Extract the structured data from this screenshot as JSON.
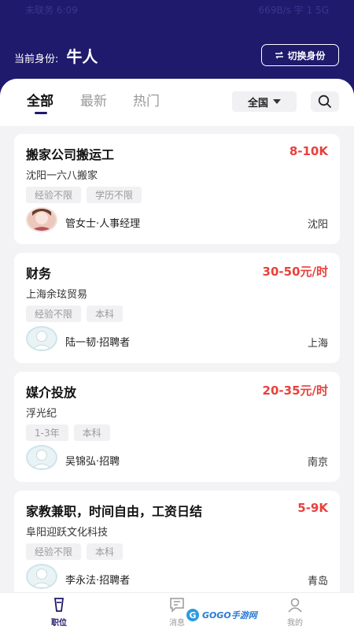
{
  "status_bar": {
    "left": "未联务 6:09",
    "right": "669B/s 宇 1 5G"
  },
  "header": {
    "identity_label": "当前身份:",
    "identity_value": "牛人",
    "switch_label": "切换身份"
  },
  "tabs": [
    {
      "label": "全部",
      "active": true
    },
    {
      "label": "最新",
      "active": false
    },
    {
      "label": "热门",
      "active": false
    }
  ],
  "region": "全国",
  "jobs": [
    {
      "title": "搬家公司搬运工",
      "salary": "8-10K",
      "company": "沈阳一六八搬家",
      "tags": [
        "经验不限",
        "学历不限"
      ],
      "recruiter": "管女士·人事经理",
      "city": "沈阳",
      "avatar": "photo"
    },
    {
      "title": "财务",
      "salary": "30-50元/时",
      "company": "上海余玹贸易",
      "tags": [
        "经验不限",
        "本科"
      ],
      "recruiter": "陆一韧·招聘者",
      "city": "上海",
      "avatar": "default"
    },
    {
      "title": "媒介投放",
      "salary": "20-35元/时",
      "company": "浮光纪",
      "tags": [
        "1-3年",
        "本科"
      ],
      "recruiter": "吴锦弘·招聘",
      "city": "南京",
      "avatar": "default"
    },
    {
      "title": "家教兼职，时间自由，工资日结",
      "salary": "5-9K",
      "company": "阜阳迎跃文化科技",
      "tags": [
        "经验不限",
        "本科"
      ],
      "recruiter": "李永法·招聘者",
      "city": "青岛",
      "avatar": "default"
    }
  ],
  "bottom_nav": [
    {
      "label": "职位",
      "icon": "briefcase-icon",
      "active": true
    },
    {
      "label": "消息",
      "icon": "message-icon",
      "active": false
    },
    {
      "label": "我的",
      "icon": "person-icon",
      "active": false
    }
  ],
  "watermark": "GOGO手游网",
  "colors": {
    "brand": "#1f1a6b",
    "salary": "#e8413c",
    "background": "#f3f3f6"
  }
}
